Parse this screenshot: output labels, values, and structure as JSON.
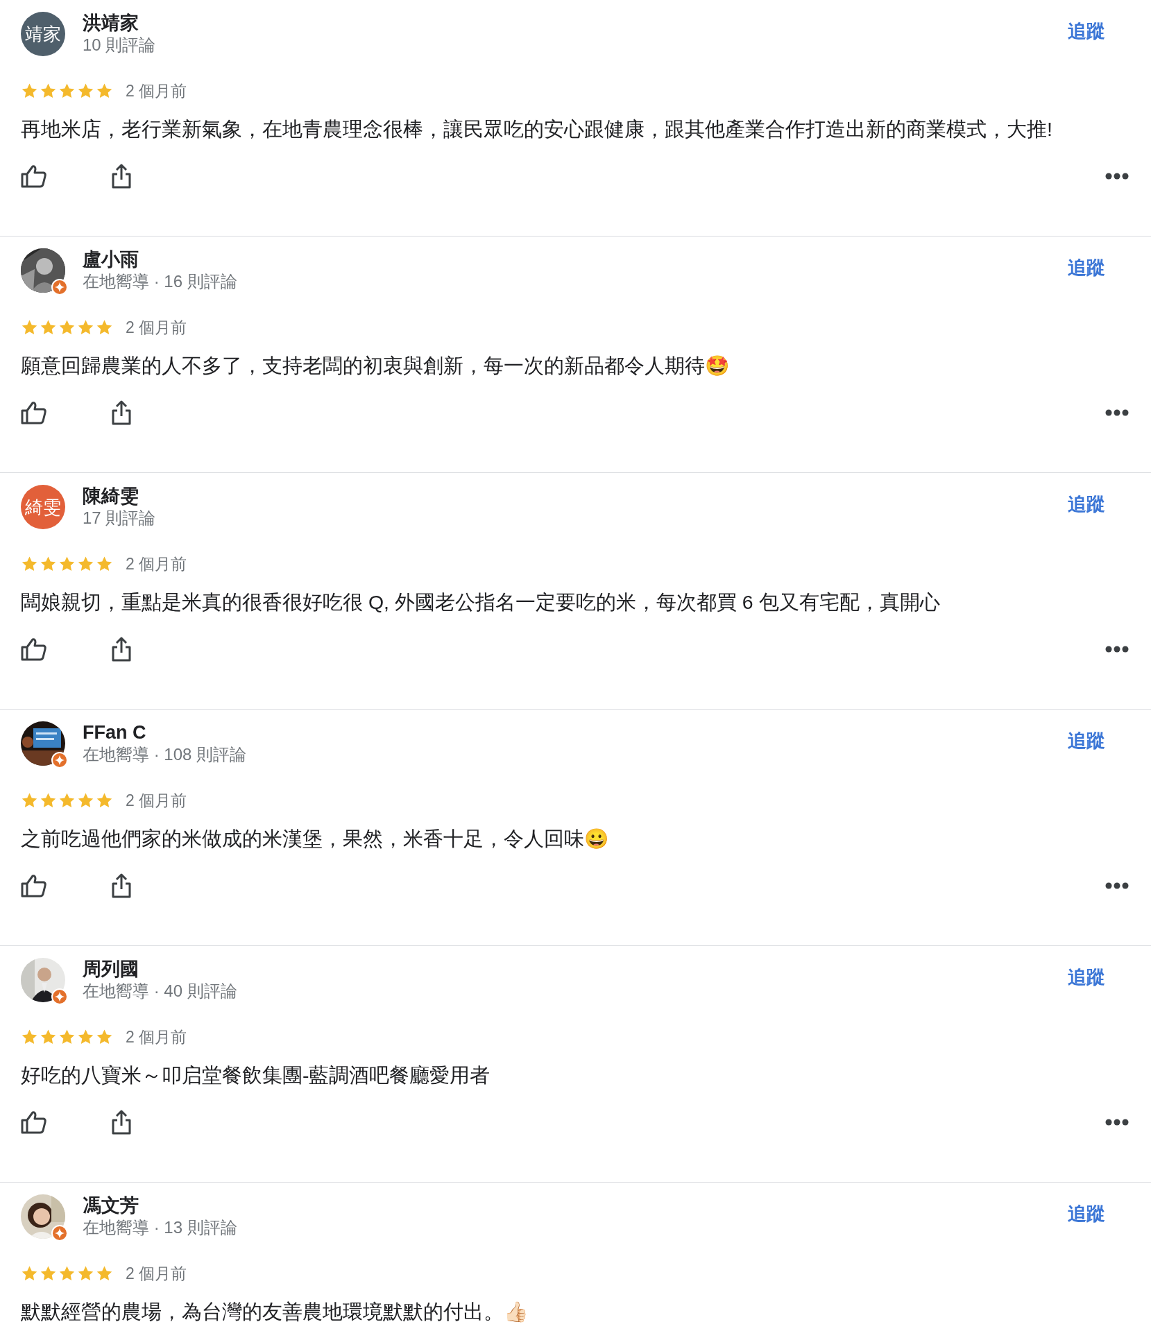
{
  "reviews": [
    {
      "name": "洪靖家",
      "avatar": {
        "kind": "initials",
        "text": "靖家",
        "color": "#4f5f6b"
      },
      "meta": "10 則評論",
      "follow": "追蹤",
      "stars": 5,
      "date": "2 個月前",
      "text": "再地米店，老行業新氣象，在地青農理念很棒，讓民眾吃的安心跟健康，跟其他產業合作打造出新的商業模式，大推!"
    },
    {
      "name": "盧小雨",
      "local_guide": true,
      "meta": "在地嚮導 · 16 則評論",
      "follow": "追蹤",
      "stars": 5,
      "date": "2 個月前",
      "text": "願意回歸農業的人不多了，支持老闆的初衷與創新，每一次的新品都令人期待🤩"
    },
    {
      "name": "陳綺雯",
      "avatar": {
        "kind": "initials",
        "text": "綺雯",
        "color": "#e2603a"
      },
      "meta": "17 則評論",
      "follow": "追蹤",
      "stars": 5,
      "date": "2 個月前",
      "text": "闆娘親切，重點是米真的很香很好吃很 Q, 外國老公指名一定要吃的米，每次都買 6 包又有宅配，真開心"
    },
    {
      "name": "FFan C",
      "local_guide": true,
      "meta": "在地嚮導 · 108 則評論",
      "follow": "追蹤",
      "stars": 5,
      "date": "2 個月前",
      "text": "之前吃過他們家的米做成的米漢堡，果然，米香十足，令人回味😀"
    },
    {
      "name": "周列國",
      "local_guide": true,
      "meta": "在地嚮導 · 40 則評論",
      "follow": "追蹤",
      "stars": 5,
      "date": "2 個月前",
      "text": "好吃的八寶米～叩启堂餐飲集團-藍調酒吧餐廳愛用者"
    },
    {
      "name": "馮文芳",
      "local_guide": true,
      "meta": "在地嚮導 · 13 則評論",
      "follow": "追蹤",
      "stars": 5,
      "date": "2 個月前",
      "text": "默默經營的農場，為台灣的友善農地環境默默的付出。👍🏻"
    }
  ]
}
